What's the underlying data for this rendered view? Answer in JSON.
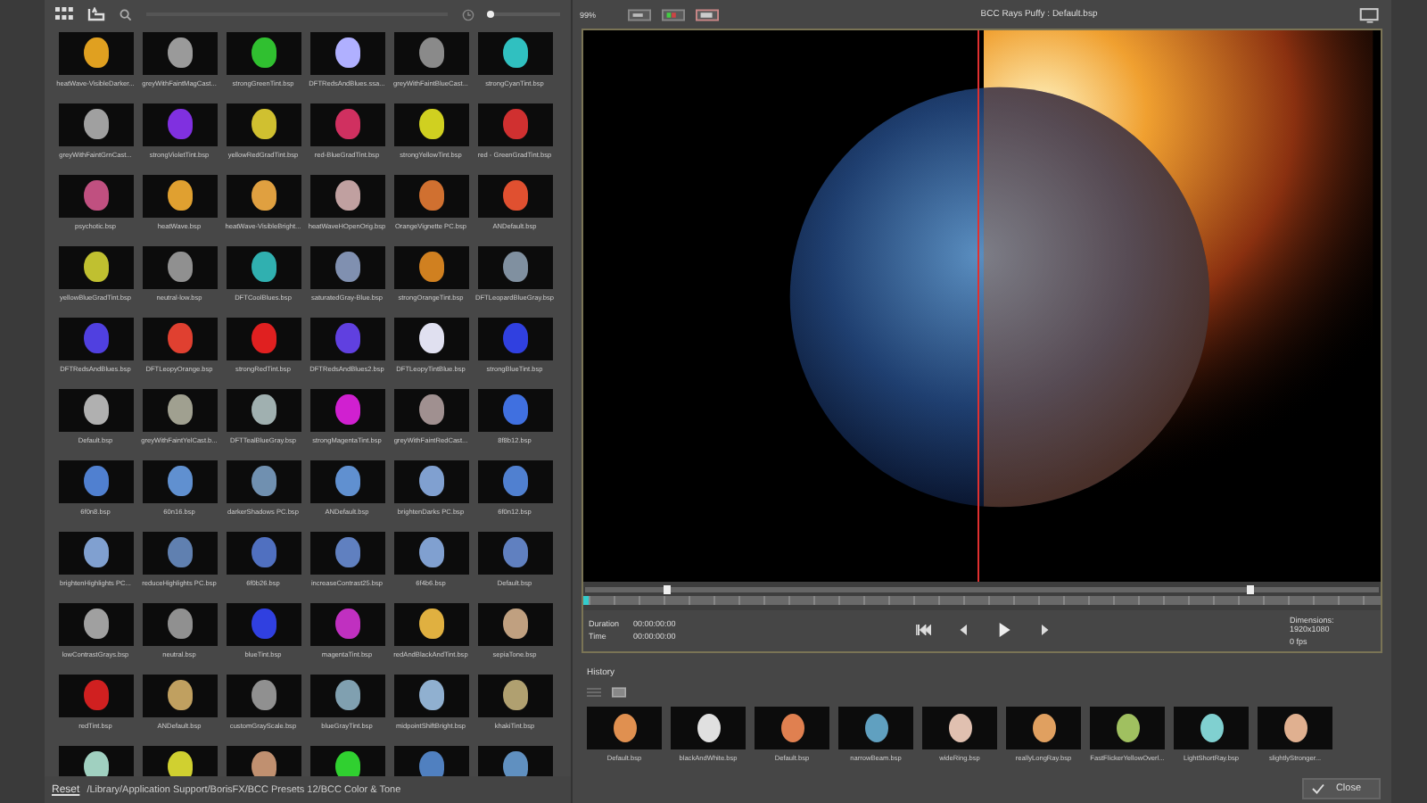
{
  "browser": {
    "zoom_slider": {
      "level": 0.02
    },
    "rows": [
      [
        {
          "label": "heatWave-VisibleDarker...",
          "color": "#e0a020"
        },
        {
          "label": "greyWithFaintMagCast...",
          "color": "#9a9a9a"
        },
        {
          "label": "strongGreenTint.bsp",
          "color": "#30c030"
        },
        {
          "label": "DFTRedsAndBlues.ssa...",
          "color": "#b0b0ff"
        },
        {
          "label": "greyWithFaintBlueCast...",
          "color": "#8a8a8a"
        },
        {
          "label": "strongCyanTint.bsp",
          "color": "#30c0c0"
        }
      ],
      [
        {
          "label": "greyWithFaintGrnCast...",
          "color": "#a0a0a0"
        },
        {
          "label": "strongVioletTint.bsp",
          "color": "#8030e0"
        },
        {
          "label": "yellowRedGradTint.bsp",
          "color": "#d0c030"
        },
        {
          "label": "red-BlueGradTint.bsp",
          "color": "#d03060"
        },
        {
          "label": "strongYellowTint.bsp",
          "color": "#d0d020"
        },
        {
          "label": "red - GreenGradTint.bsp",
          "color": "#d03030"
        }
      ],
      [
        {
          "label": "psychotic.bsp",
          "color": "#c05080"
        },
        {
          "label": "heatWave.bsp",
          "color": "#e0a030"
        },
        {
          "label": "heatWave-VisibleBright...",
          "color": "#e0a040"
        },
        {
          "label": "heatWaveHOpenOrig.bsp",
          "color": "#c0a0a0"
        },
        {
          "label": "OrangeVignette PC.bsp",
          "color": "#d07030"
        },
        {
          "label": "ANDefault.bsp",
          "color": "#e05030"
        }
      ],
      [
        {
          "label": "yellowBlueGradTint.bsp",
          "color": "#c0c030"
        },
        {
          "label": "neutral-low.bsp",
          "color": "#909090"
        },
        {
          "label": "DFTCoolBlues.bsp",
          "color": "#30b0b0"
        },
        {
          "label": "saturatedGray-Blue.bsp",
          "color": "#8090b0"
        },
        {
          "label": "strongOrangeTint.bsp",
          "color": "#d08020"
        },
        {
          "label": "DFTLeopardBlueGray.bsp",
          "color": "#8090a0"
        }
      ],
      [
        {
          "label": "DFTRedsAndBlues.bsp",
          "color": "#5040e0"
        },
        {
          "label": "DFTLeopyOrange.bsp",
          "color": "#e04030"
        },
        {
          "label": "strongRedTint.bsp",
          "color": "#e02020"
        },
        {
          "label": "DFTRedsAndBlues2.bsp",
          "color": "#6040e0"
        },
        {
          "label": "DFTLeopyTintBlue.bsp",
          "color": "#e0e0f0"
        },
        {
          "label": "strongBlueTint.bsp",
          "color": "#3040e0"
        }
      ],
      [
        {
          "label": "Default.bsp",
          "color": "#b0b0b0"
        },
        {
          "label": "greyWithFaintYelCast.b...",
          "color": "#a0a090"
        },
        {
          "label": "DFTTealBlueGray.bsp",
          "color": "#a0b0b0"
        },
        {
          "label": "strongMagentaTint.bsp",
          "color": "#d020d0"
        },
        {
          "label": "greyWithFaintRedCast...",
          "color": "#a09090"
        },
        {
          "label": "8f8b12.bsp",
          "color": "#4070e0"
        }
      ],
      [
        {
          "label": "6f0n8.bsp",
          "color": "#5080d0"
        },
        {
          "label": "60n16.bsp",
          "color": "#6090d0"
        },
        {
          "label": "darkerShadows PC.bsp",
          "color": "#7090b0"
        },
        {
          "label": "ANDefault.bsp",
          "color": "#6090d0"
        },
        {
          "label": "brightenDarks PC.bsp",
          "color": "#80a0d0"
        },
        {
          "label": "6f0n12.bsp",
          "color": "#5080d0"
        }
      ],
      [
        {
          "label": "brightenHighlights PC...",
          "color": "#80a0d0"
        },
        {
          "label": "reduceHighlights PC.bsp",
          "color": "#6080b0"
        },
        {
          "label": "6f0b26.bsp",
          "color": "#5070c0"
        },
        {
          "label": "increaseContrast25.bsp",
          "color": "#6080c0"
        },
        {
          "label": "6f4b6.bsp",
          "color": "#80a0d0"
        },
        {
          "label": "Default.bsp",
          "color": "#6080c0"
        }
      ],
      [
        {
          "label": "lowContrastGrays.bsp",
          "color": "#a0a0a0"
        },
        {
          "label": "neutral.bsp",
          "color": "#909090"
        },
        {
          "label": "blueTint.bsp",
          "color": "#3040e0"
        },
        {
          "label": "magentaTint.bsp",
          "color": "#c030c0"
        },
        {
          "label": "redAndBlackAndTint.bsp",
          "color": "#e0b040"
        },
        {
          "label": "sepiaTone.bsp",
          "color": "#c0a080"
        }
      ],
      [
        {
          "label": "redTint.bsp",
          "color": "#d02020"
        },
        {
          "label": "ANDefault.bsp",
          "color": "#c0a060"
        },
        {
          "label": "customGrayScale.bsp",
          "color": "#909090"
        },
        {
          "label": "blueGrayTint.bsp",
          "color": "#80a0b0"
        },
        {
          "label": "midpointShiftBright.bsp",
          "color": "#90b0d0"
        },
        {
          "label": "khakiTint.bsp",
          "color": "#b0a070"
        }
      ],
      [
        {
          "color": "#a0d0c0"
        },
        {
          "color": "#d0d030"
        },
        {
          "color": "#c09070"
        },
        {
          "color": "#30d030"
        },
        {
          "color": "#5080c0"
        },
        {
          "color": "#6090c0"
        }
      ]
    ],
    "reset": "Reset",
    "path": "/Library/Application Support/BorisFX/BCC Presets 12/BCC Color & Tone"
  },
  "preview": {
    "zoom": "99%",
    "title": "BCC Rays Puffy : Default.bsp",
    "duration_label": "Duration",
    "duration": "00:00:00:00",
    "time_label": "Time",
    "time": "00:00:00:00",
    "dimensions": "Dimensions: 1920x1080",
    "fps": "0 fps"
  },
  "history": {
    "title": "History",
    "items": [
      {
        "label": "Default.bsp",
        "color": "#e09050"
      },
      {
        "label": "blackAndWhite.bsp",
        "color": "#e0e0e0"
      },
      {
        "label": "Default.bsp",
        "color": "#e08050"
      },
      {
        "label": "narrowBeam.bsp",
        "color": "#60a0c0"
      },
      {
        "label": "wideRing.bsp",
        "color": "#e0c0b0"
      },
      {
        "label": "reallyLongRay.bsp",
        "color": "#e0a060"
      },
      {
        "label": "FastFlickerYellowOverl...",
        "color": "#a0c060"
      },
      {
        "label": "LightShortRay.bsp",
        "color": "#80d0d0"
      },
      {
        "label": "slightlyStronger...",
        "color": "#e0b090"
      }
    ]
  },
  "close": "Close"
}
